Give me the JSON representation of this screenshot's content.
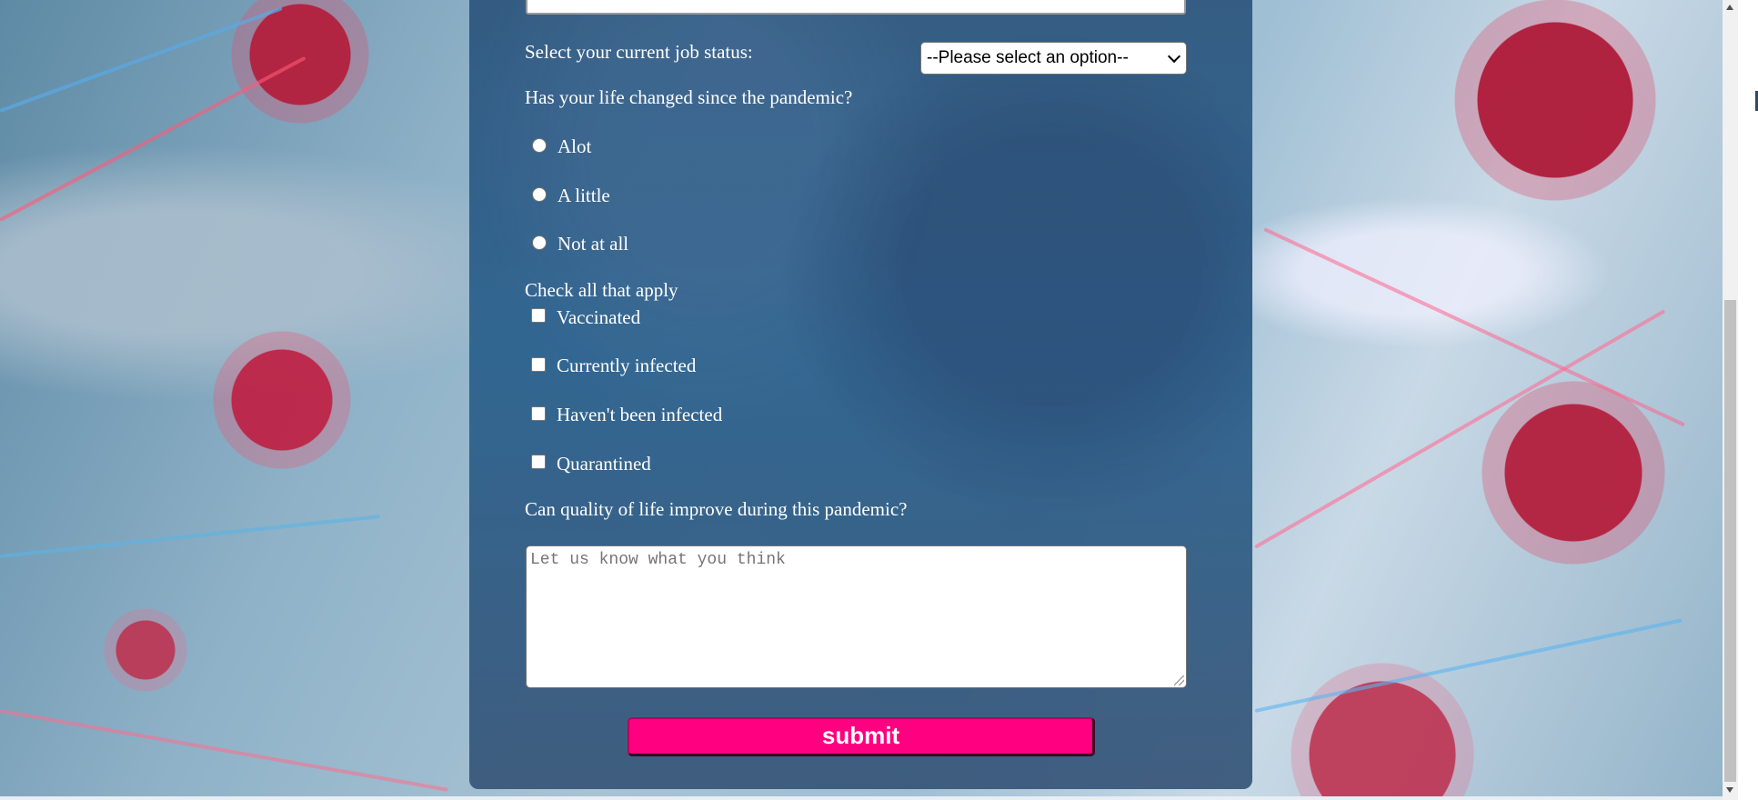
{
  "form": {
    "job_status_label": "Select your current job status:",
    "job_status_select": {
      "selected": "--Please select an option--"
    },
    "life_changed": {
      "question": "Has your life changed since the pandemic?",
      "options": [
        "Alot",
        "A little",
        "Not at all"
      ]
    },
    "check_all": {
      "heading": "Check all that apply",
      "options": [
        "Vaccinated",
        "Currently infected",
        "Haven't been infected",
        "Quarantined"
      ]
    },
    "quality_question": "Can quality of life improve during this pandemic?",
    "comment_placeholder": "Let us know what you think",
    "submit_label": "submit"
  },
  "colors": {
    "accent": "#ff0080",
    "panel": "#2d557d",
    "text": "#ffffff"
  }
}
